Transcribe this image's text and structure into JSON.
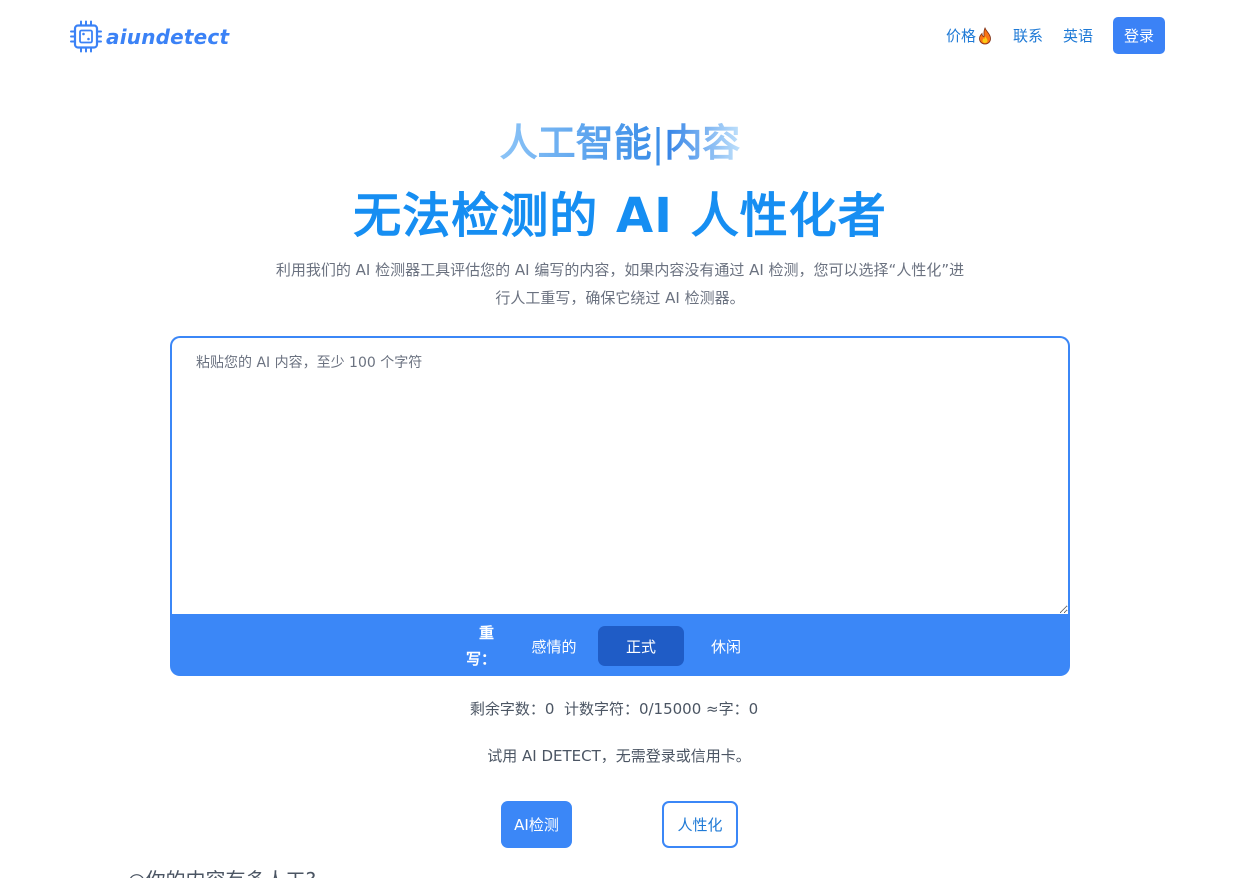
{
  "brand": {
    "name": "aiundetect",
    "logo_icon": "chip-icon"
  },
  "nav": {
    "pricing": "价格",
    "pricing_icon": "flame-icon",
    "contact": "联系",
    "language": "英语",
    "login": "登录"
  },
  "hero": {
    "eyebrow_part1": "人工智能",
    "eyebrow_cursor": "|",
    "eyebrow_part2": "内容",
    "title": "无法检测的 AI 人性化者",
    "subtitle": "利用我们的 AI 检测器工具评估您的 AI 编写的内容，如果内容没有通过 AI 检测，您可以选择“人性化”进行人工重写，确保它绕过 AI 检测器。"
  },
  "editor": {
    "placeholder": "粘贴您的 AI 内容，至少 100 个字符",
    "value": "",
    "rewrite_label": "重写：",
    "modes": [
      "感情的",
      "正式",
      "休闲"
    ],
    "selected_mode": "正式"
  },
  "stats": {
    "text": "剩余字数：0  计数字符：0/15000 ≈字：0"
  },
  "trial": "试用 AI DETECT，无需登录或信用卡。",
  "actions": {
    "detect": "AI检测",
    "humanize": "人性化"
  },
  "faq_question": "○你的内容有多人工?",
  "colors": {
    "primary": "#3b87f7",
    "selected_mode": "#1f5cc6",
    "title": "#168ef2",
    "link": "#1f7ad6"
  }
}
